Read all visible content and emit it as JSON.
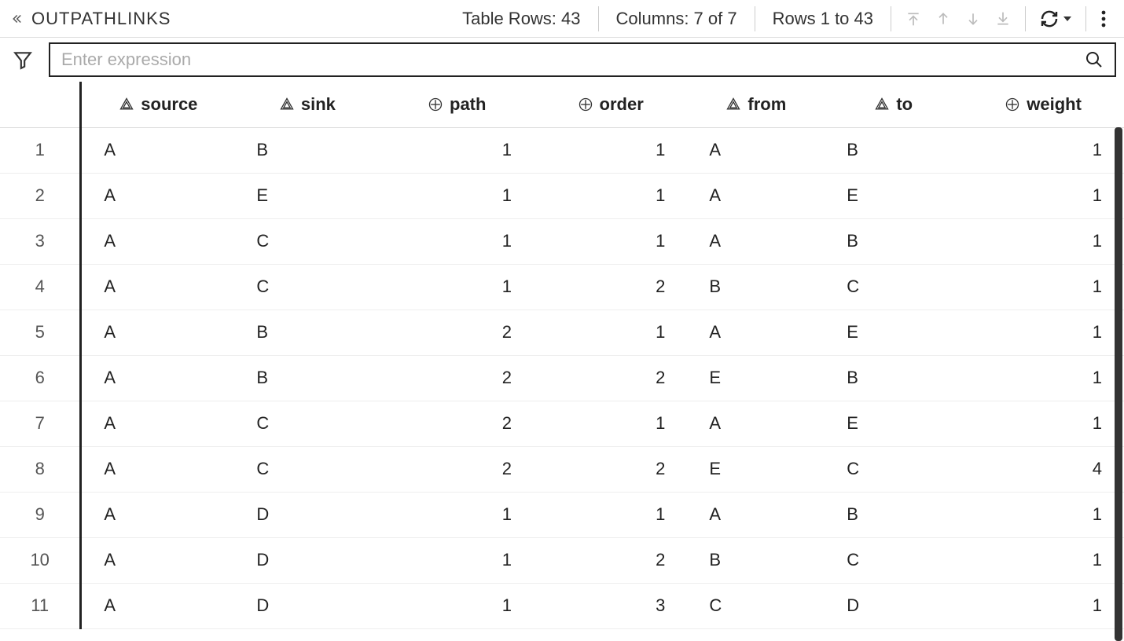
{
  "toolbar": {
    "title": "OUTPATHLINKS",
    "rows_label": "Table Rows: 43",
    "columns_label": "Columns: 7 of 7",
    "range_label": "Rows 1 to 43"
  },
  "filter": {
    "placeholder": "Enter expression"
  },
  "columns": [
    {
      "key": "source",
      "label": "source",
      "type": "text"
    },
    {
      "key": "sink",
      "label": "sink",
      "type": "text"
    },
    {
      "key": "path",
      "label": "path",
      "type": "num"
    },
    {
      "key": "order",
      "label": "order",
      "type": "num"
    },
    {
      "key": "from",
      "label": "from",
      "type": "text"
    },
    {
      "key": "to",
      "label": "to",
      "type": "text"
    },
    {
      "key": "weight",
      "label": "weight",
      "type": "num"
    }
  ],
  "rows": [
    {
      "n": 1,
      "source": "A",
      "sink": "B",
      "path": 1,
      "order": 1,
      "from": "A",
      "to": "B",
      "weight": 1
    },
    {
      "n": 2,
      "source": "A",
      "sink": "E",
      "path": 1,
      "order": 1,
      "from": "A",
      "to": "E",
      "weight": 1
    },
    {
      "n": 3,
      "source": "A",
      "sink": "C",
      "path": 1,
      "order": 1,
      "from": "A",
      "to": "B",
      "weight": 1
    },
    {
      "n": 4,
      "source": "A",
      "sink": "C",
      "path": 1,
      "order": 2,
      "from": "B",
      "to": "C",
      "weight": 1
    },
    {
      "n": 5,
      "source": "A",
      "sink": "B",
      "path": 2,
      "order": 1,
      "from": "A",
      "to": "E",
      "weight": 1
    },
    {
      "n": 6,
      "source": "A",
      "sink": "B",
      "path": 2,
      "order": 2,
      "from": "E",
      "to": "B",
      "weight": 1
    },
    {
      "n": 7,
      "source": "A",
      "sink": "C",
      "path": 2,
      "order": 1,
      "from": "A",
      "to": "E",
      "weight": 1
    },
    {
      "n": 8,
      "source": "A",
      "sink": "C",
      "path": 2,
      "order": 2,
      "from": "E",
      "to": "C",
      "weight": 4
    },
    {
      "n": 9,
      "source": "A",
      "sink": "D",
      "path": 1,
      "order": 1,
      "from": "A",
      "to": "B",
      "weight": 1
    },
    {
      "n": 10,
      "source": "A",
      "sink": "D",
      "path": 1,
      "order": 2,
      "from": "B",
      "to": "C",
      "weight": 1
    },
    {
      "n": 11,
      "source": "A",
      "sink": "D",
      "path": 1,
      "order": 3,
      "from": "C",
      "to": "D",
      "weight": 1
    }
  ]
}
